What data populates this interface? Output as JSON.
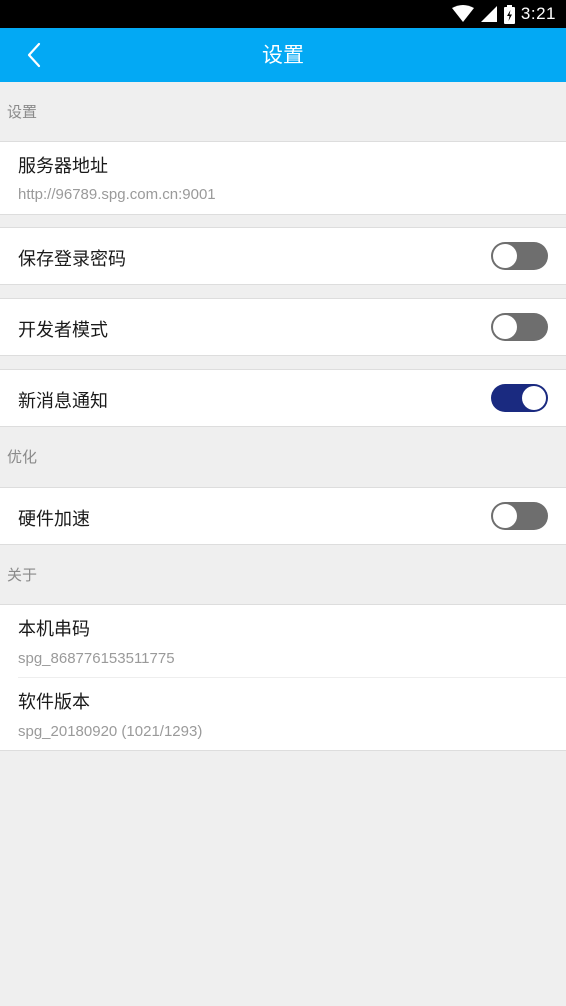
{
  "status_bar": {
    "time": "3:21",
    "icons": [
      "wifi-icon",
      "cell-signal-icon",
      "battery-icon"
    ]
  },
  "app_bar": {
    "title": "设置",
    "back_icon": "chevron-left-icon",
    "color": "#03a9f4"
  },
  "sections": {
    "settings": {
      "header": "设置"
    },
    "optimize": {
      "header": "优化"
    },
    "about": {
      "header": "关于"
    }
  },
  "items": {
    "server_address": {
      "label": "服务器地址",
      "value": "http://96789.spg.com.cn:9001"
    },
    "save_password": {
      "label": "保存登录密码",
      "enabled": false
    },
    "developer_mode": {
      "label": "开发者模式",
      "enabled": false
    },
    "new_message_notify": {
      "label": "新消息通知",
      "enabled": true
    },
    "hardware_accel": {
      "label": "硬件加速",
      "enabled": false
    },
    "device_serial": {
      "label": "本机串码",
      "value": "spg_868776153511775"
    },
    "software_version": {
      "label": "软件版本",
      "value": "spg_20180920 (1021/1293)"
    }
  },
  "colors": {
    "toggle_off": "#6e6e6e",
    "toggle_on": "#1a2a80"
  }
}
